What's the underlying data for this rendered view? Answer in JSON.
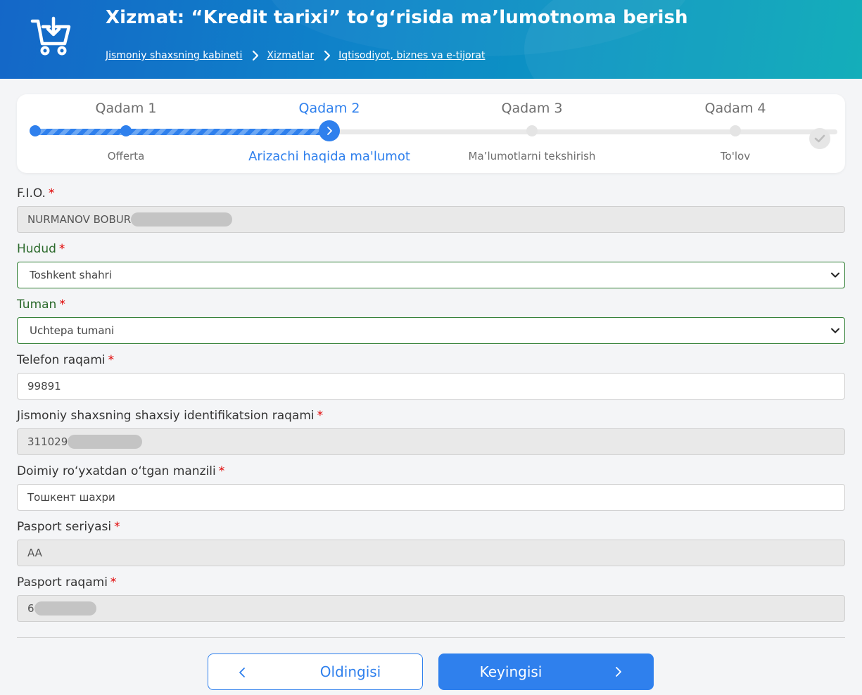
{
  "header": {
    "title": "Xizmat: “Kredit tarixi” to‘g‘risida ma’lumotnoma berish",
    "icon": "cart-download-icon",
    "breadcrumb": [
      "Jismoniy shaxsning kabineti",
      "Xizmatlar",
      "Iqtisodiyot, biznes va e-tijorat"
    ]
  },
  "stepper": {
    "steps": [
      {
        "title": "Qadam 1",
        "subtitle": "Offerta",
        "state": "done"
      },
      {
        "title": "Qadam 2",
        "subtitle": "Arizachi haqida ma'lumot",
        "state": "active"
      },
      {
        "title": "Qadam 3",
        "subtitle": "Ma’lumotlarni tekshirish",
        "state": "pending"
      },
      {
        "title": "Qadam 4",
        "subtitle": "To'lov",
        "state": "pending"
      }
    ],
    "accent": "#2f80ed"
  },
  "form": {
    "required_mark": "*",
    "fio": {
      "label": "F.I.O.",
      "value": "NURMANOV BOBUR"
    },
    "hudud": {
      "label": "Hudud",
      "value": "Toshkent shahri"
    },
    "tuman": {
      "label": "Tuman",
      "value": "Uchtepa tumani"
    },
    "telefon": {
      "label": "Telefon raqami",
      "value": "99891"
    },
    "jshshir": {
      "label": "Jismoniy shaxsning shaxsiy identifikatsion raqami",
      "value": "311029"
    },
    "manzil": {
      "label": "Doimiy ro‘yxatdan o‘tgan manzili",
      "value": "Тошкент шахри"
    },
    "pasport_seriya": {
      "label": "Pasport seriyasi",
      "value": "AA"
    },
    "pasport_raqam": {
      "label": "Pasport raqami",
      "value": "6"
    }
  },
  "buttons": {
    "prev": "Oldingisi",
    "next": "Keyingisi"
  }
}
